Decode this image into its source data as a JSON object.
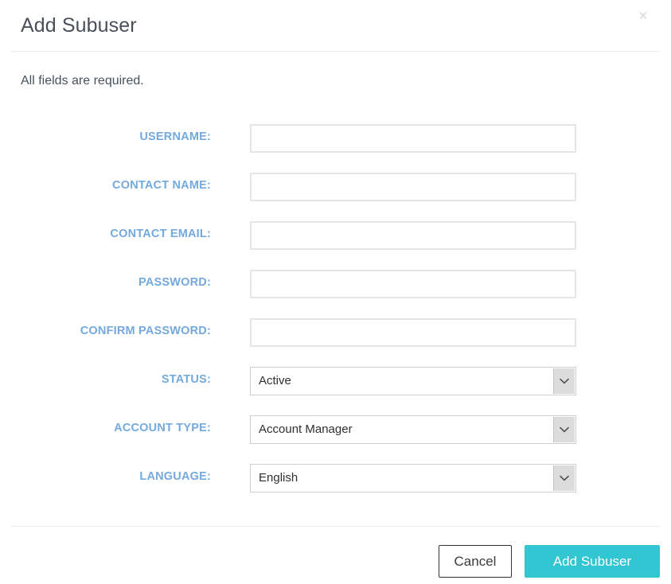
{
  "modal": {
    "title": "Add Subuser",
    "close_icon": "close-icon",
    "required_note": "All fields are required.",
    "accent_color": "#32c5d2",
    "label_color": "#74a9dd"
  },
  "form": {
    "fields": [
      {
        "label": "USERNAME:",
        "type": "text",
        "value": "",
        "placeholder": "",
        "name": "username"
      },
      {
        "label": "CONTACT NAME:",
        "type": "text",
        "value": "",
        "placeholder": "",
        "name": "contact-name"
      },
      {
        "label": "CONTACT EMAIL:",
        "type": "text",
        "value": "",
        "placeholder": "",
        "name": "contact-email"
      },
      {
        "label": "PASSWORD:",
        "type": "text",
        "value": "",
        "placeholder": "",
        "name": "password"
      },
      {
        "label": "CONFIRM PASSWORD:",
        "type": "text",
        "value": "",
        "placeholder": "",
        "name": "confirm-password"
      },
      {
        "label": "STATUS:",
        "type": "select",
        "value": "Active",
        "name": "status"
      },
      {
        "label": "ACCOUNT TYPE:",
        "type": "select",
        "value": "Account Manager",
        "name": "account-type"
      },
      {
        "label": "LANGUAGE:",
        "type": "select",
        "value": "English",
        "name": "language"
      }
    ]
  },
  "footer": {
    "cancel_label": "Cancel",
    "submit_label": "Add Subuser"
  }
}
